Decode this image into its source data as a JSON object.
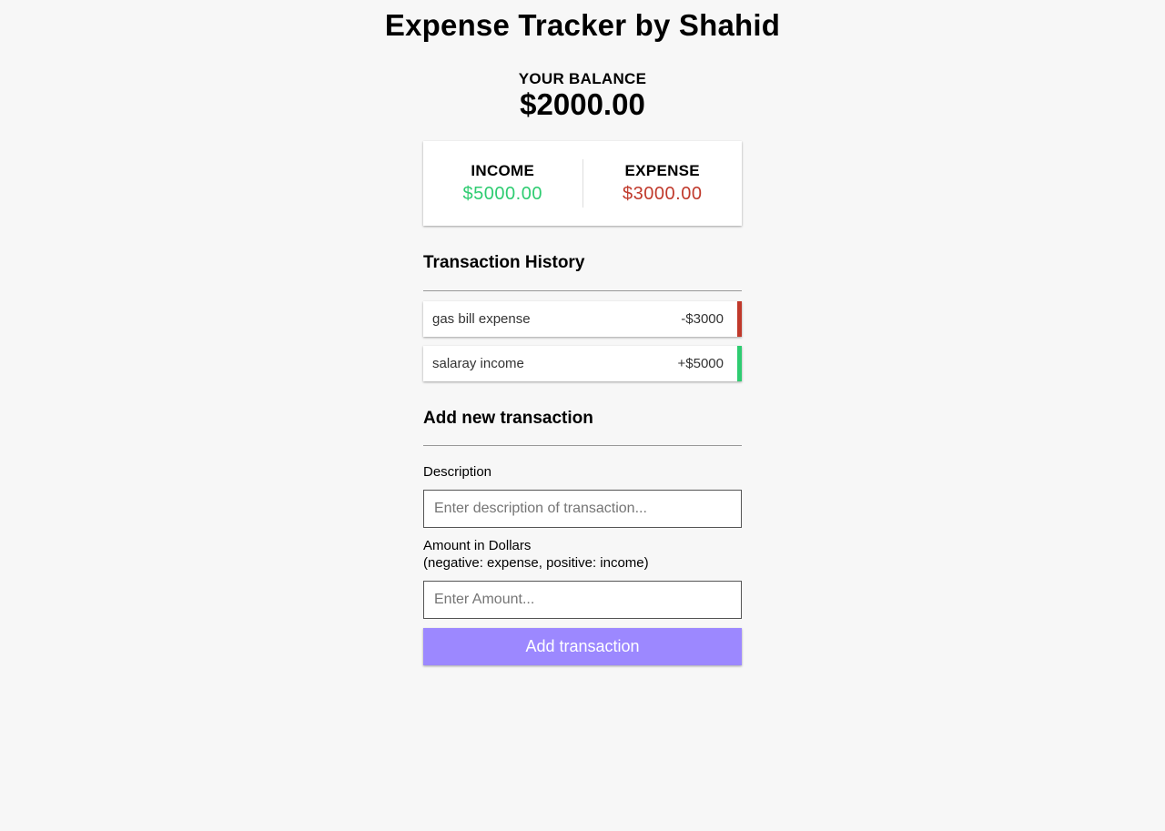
{
  "app": {
    "title": "Expense Tracker by Shahid"
  },
  "balance": {
    "label": "YOUR BALANCE",
    "value": "$2000.00"
  },
  "summary": {
    "income_label": "INCOME",
    "income_value": "$5000.00",
    "expense_label": "EXPENSE",
    "expense_value": "$3000.00"
  },
  "history": {
    "title": "Transaction History",
    "transactions": [
      {
        "description": "gas bill expense",
        "amount": "-$3000",
        "type": "minus"
      },
      {
        "description": "salaray income",
        "amount": "+$5000",
        "type": "plus"
      }
    ]
  },
  "form": {
    "title": "Add new transaction",
    "description_label": "Description",
    "description_placeholder": "Enter description of transaction...",
    "description_value": "",
    "amount_label_line1": "Amount in Dollars",
    "amount_label_line2": "(negative: expense, positive: income)",
    "amount_placeholder": "Enter Amount...",
    "amount_value": "",
    "submit_label": "Add transaction"
  },
  "colors": {
    "background": "#f7f7f7",
    "income": "#2ecc71",
    "expense": "#c0392b",
    "button": "#9c88ff"
  }
}
